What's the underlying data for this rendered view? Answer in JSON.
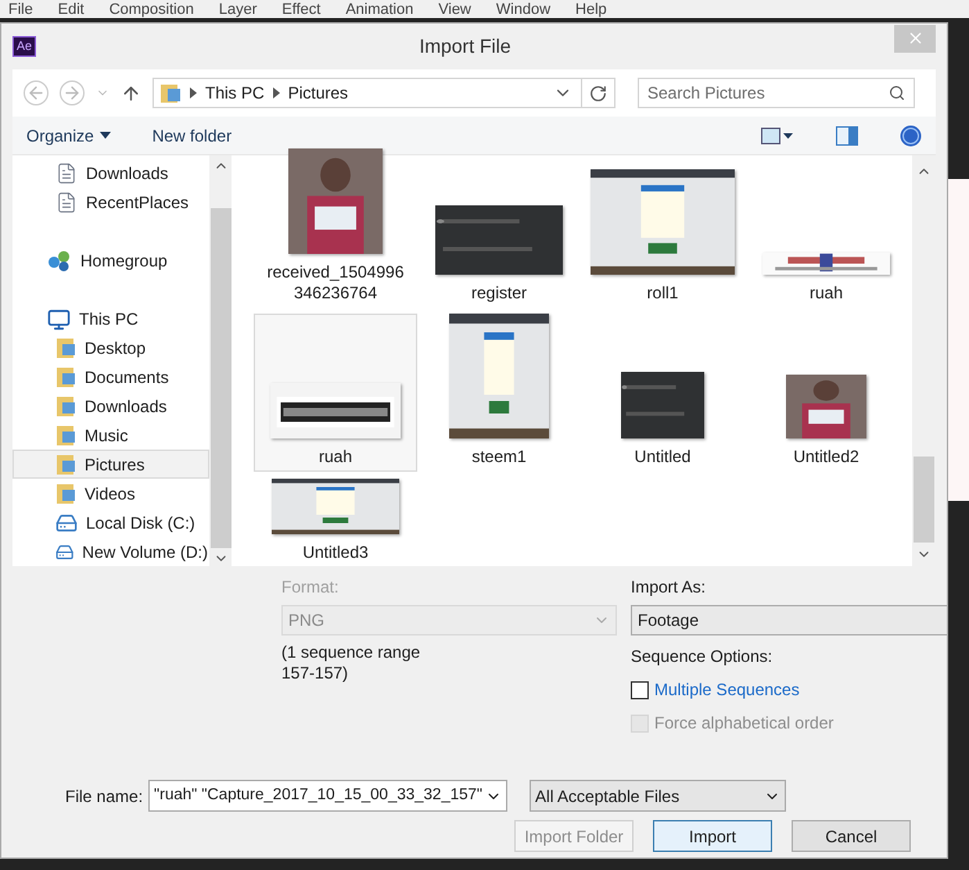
{
  "menu_bar": [
    "File",
    "Edit",
    "Composition",
    "Layer",
    "Effect",
    "Animation",
    "View",
    "Window",
    "Help"
  ],
  "window": {
    "app_badge": "Ae",
    "title": "Import File"
  },
  "address_bar": {
    "path": [
      "This PC",
      "Pictures"
    ],
    "search_placeholder": "Search Pictures"
  },
  "toolbar": {
    "organize": "Organize",
    "new_folder": "New folder"
  },
  "sidebar": [
    {
      "kind": "file",
      "label": "Downloads",
      "selected": false
    },
    {
      "kind": "file",
      "label": "RecentPlaces",
      "selected": false
    },
    {
      "kind": "group",
      "label": "Homegroup",
      "selected": false
    },
    {
      "kind": "pc",
      "label": "This PC",
      "selected": false
    },
    {
      "kind": "folder",
      "label": "Desktop",
      "selected": false
    },
    {
      "kind": "folder",
      "label": "Documents",
      "selected": false
    },
    {
      "kind": "folder",
      "label": "Downloads",
      "selected": false
    },
    {
      "kind": "folder",
      "label": "Music",
      "selected": false
    },
    {
      "kind": "folder",
      "label": "Pictures",
      "selected": true
    },
    {
      "kind": "folder",
      "label": "Videos",
      "selected": false
    },
    {
      "kind": "drive",
      "label": "Local Disk (C:)",
      "selected": false
    },
    {
      "kind": "drive",
      "label": "New Volume (D:)",
      "selected": false
    }
  ],
  "files": [
    {
      "name": "received_1504996346236764",
      "selected": false
    },
    {
      "name": "register",
      "selected": false
    },
    {
      "name": "roll1",
      "selected": false
    },
    {
      "name": "ruah",
      "selected": false
    },
    {
      "name": "ruah",
      "selected": true
    },
    {
      "name": "steem1",
      "selected": false
    },
    {
      "name": "Untitled",
      "selected": false
    },
    {
      "name": "Untitled2",
      "selected": false
    },
    {
      "name": "Untitled3",
      "selected": false
    }
  ],
  "options": {
    "format_label": "Format:",
    "format_value": "PNG",
    "sequence_info": "(1 sequence range 157-157)",
    "import_as_label": "Import As:",
    "import_as_value": "Footage",
    "sequence_options_label": "Sequence Options:",
    "checkboxes": [
      {
        "label": "Multiple Sequences",
        "checked": false,
        "disabled": false
      },
      {
        "label": "Force alphabetical order",
        "checked": false,
        "disabled": true
      }
    ]
  },
  "footer": {
    "file_name_label": "File name:",
    "file_name_value": "\"ruah\" \"Capture_2017_10_15_00_33_32_157\"",
    "file_type": "All Acceptable Files",
    "buttons": [
      {
        "label": "Import Folder",
        "disabled": true,
        "default": false
      },
      {
        "label": "Import",
        "disabled": false,
        "default": true
      },
      {
        "label": "Cancel",
        "disabled": false,
        "default": false
      }
    ]
  }
}
